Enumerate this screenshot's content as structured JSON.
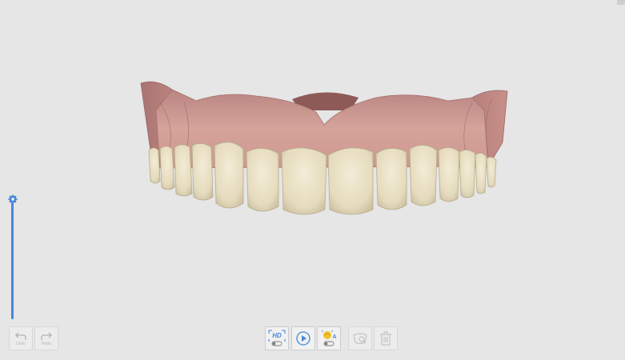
{
  "history": {
    "undo_label": "Undo",
    "redo_label": "Redo"
  },
  "toolbar": {
    "hd_label": "HD"
  },
  "colors": {
    "accent": "#4a86d8",
    "ai_accent": "#f2c230",
    "gum": "#c68e87",
    "tooth": "#e9e0c4"
  },
  "icons": [
    "undo-icon",
    "redo-icon",
    "hd-scan-icon",
    "play-icon",
    "ai-scan-icon",
    "inspect-icon",
    "trash-icon",
    "gear-icon"
  ]
}
